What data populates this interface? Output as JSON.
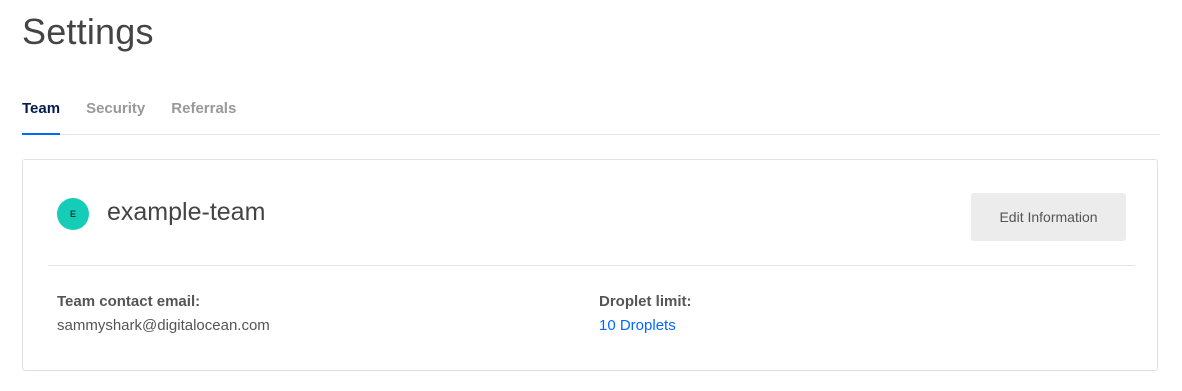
{
  "page": {
    "title": "Settings"
  },
  "tabs": [
    {
      "label": "Team",
      "active": true
    },
    {
      "label": "Security",
      "active": false
    },
    {
      "label": "Referrals",
      "active": false
    }
  ],
  "team": {
    "avatar_initial": "E",
    "avatar_color": "#15cdb7",
    "name": "example-team",
    "edit_label": "Edit Information",
    "contact_email_label": "Team contact email:",
    "contact_email": "sammyshark@digitalocean.com",
    "droplet_limit_label": "Droplet limit:",
    "droplet_limit": "10 Droplets"
  },
  "colors": {
    "accent": "#0069ff",
    "active_tab_text": "#031b4e"
  }
}
